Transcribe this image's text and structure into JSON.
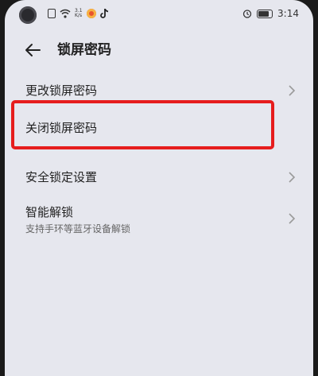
{
  "status_bar": {
    "speed_top": "3.1",
    "speed_bottom": "K/s",
    "time": "3:14"
  },
  "header": {
    "title": "锁屏密码"
  },
  "items": [
    {
      "label": "更改锁屏密码",
      "has_chevron": true
    },
    {
      "label": "关闭锁屏密码",
      "has_chevron": false,
      "highlighted": true
    },
    {
      "label": "安全锁定设置",
      "has_chevron": true
    },
    {
      "label": "智能解锁",
      "subtitle": "支持手环等蓝牙设备解锁",
      "has_chevron": true
    }
  ],
  "colors": {
    "background": "#e6e7ee",
    "text": "#222222",
    "subtext": "#666666",
    "highlight": "#e61d1d",
    "chevron": "#9a9a9a"
  },
  "icons": {
    "back": "arrow-left-icon",
    "chevron": "chevron-right-icon",
    "alarm": "alarm-icon",
    "battery": "battery-icon",
    "wifi": "wifi-icon"
  }
}
